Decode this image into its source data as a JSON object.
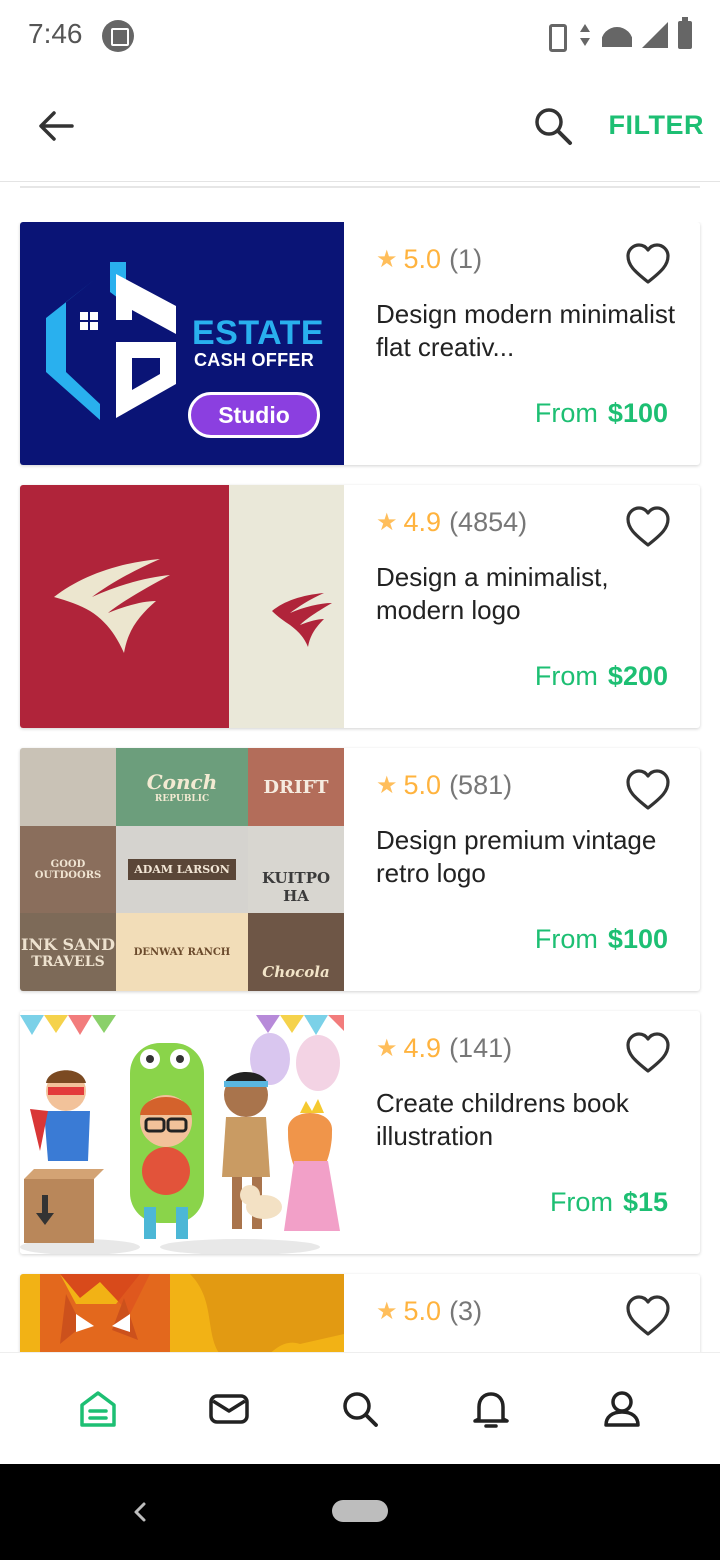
{
  "status_bar": {
    "time": "7:46"
  },
  "toolbar": {
    "filter_label": "FILTER"
  },
  "colors": {
    "accent": "#1dbf73",
    "star": "#ffb33e",
    "studio": "#8b3fe0"
  },
  "gigs": [
    {
      "rating": "5.0",
      "reviews": "(1)",
      "title": "Design modern minimalist flat creativ...",
      "price_prefix": "From",
      "price": "$100",
      "image": {
        "line1": "ESTATE",
        "line2": "CASH OFFER",
        "badge": "Studio"
      }
    },
    {
      "rating": "4.9",
      "reviews": "(4854)",
      "title": "Design a minimalist, modern logo",
      "price_prefix": "From",
      "price": "$200"
    },
    {
      "rating": "5.0",
      "reviews": "(581)",
      "title": "Design premium vintage retro logo",
      "price_prefix": "From",
      "price": "$100",
      "image": {
        "t1": "Conch",
        "t1b": "REPUBLIC",
        "t2": "DRIFT",
        "t3": "GOOD OUTDOORS",
        "t4": "ADAM LARSON",
        "t5": "KUITPO HA",
        "t6": "INK SAND",
        "t6b": "TRAVELS",
        "t7": "DENWAY RANCH",
        "t8": "Chocola"
      }
    },
    {
      "rating": "4.9",
      "reviews": "(141)",
      "title": "Create childrens book illustration",
      "price_prefix": "From",
      "price": "$15"
    },
    {
      "rating": "5.0",
      "reviews": "(3)",
      "title": "",
      "price_prefix": "",
      "price": ""
    }
  ],
  "bottom_nav": [
    "home-icon",
    "inbox-icon",
    "search-icon",
    "notifications-icon",
    "profile-icon"
  ]
}
